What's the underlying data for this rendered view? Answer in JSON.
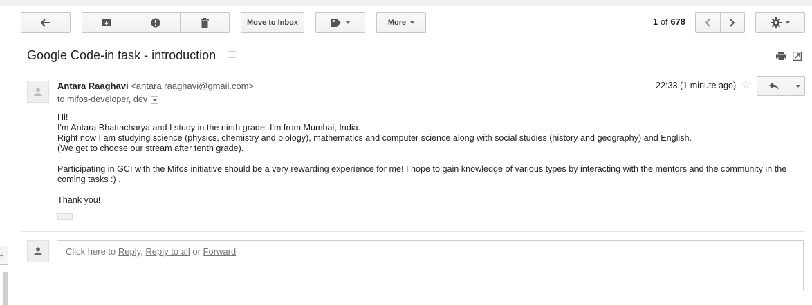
{
  "toolbar": {
    "move_to_inbox_label": "Move to Inbox",
    "more_label": "More",
    "page_current": "1",
    "page_of": "of",
    "page_total": "678"
  },
  "subject": "Google Code-in task - introduction",
  "message": {
    "sender_name": "Antara Raaghavi",
    "sender_email": "<antara.raaghavi@gmail.com>",
    "to_line": "to mifos-developer, dev",
    "time": "22:33 (1 minute ago)",
    "body": {
      "line1": "Hi!",
      "line2": "I'm Antara Bhattacharya and I study in the ninth grade. I'm from Mumbai, India.",
      "line3": "Right now I am studying science (physics, chemistry and biology), mathematics and computer science along with social studies (history and geography) and English.",
      "line4": "(We get to choose our stream after tenth grade).",
      "line5": "Participating in GCI with the Mifos initiative should be a very rewarding experience for me! I hope to gain knowledge of various types by interacting with the mentors and the community in the coming tasks :) .",
      "line6": "Thank you!"
    },
    "ellipsis": "..."
  },
  "reply_box": {
    "prefix": "Click here to",
    "reply": "Reply",
    "comma": ",",
    "reply_all": "Reply to all",
    "or": "or",
    "forward": "Forward"
  },
  "left_edge_symbol": "+",
  "icons": [
    "back-arrow-icon",
    "archive-icon",
    "report-spam-icon",
    "trash-icon",
    "label-icon",
    "chevron-left-icon",
    "chevron-right-icon",
    "gear-icon",
    "print-icon",
    "new-window-icon",
    "avatar-icon",
    "star-icon",
    "reply-icon"
  ]
}
